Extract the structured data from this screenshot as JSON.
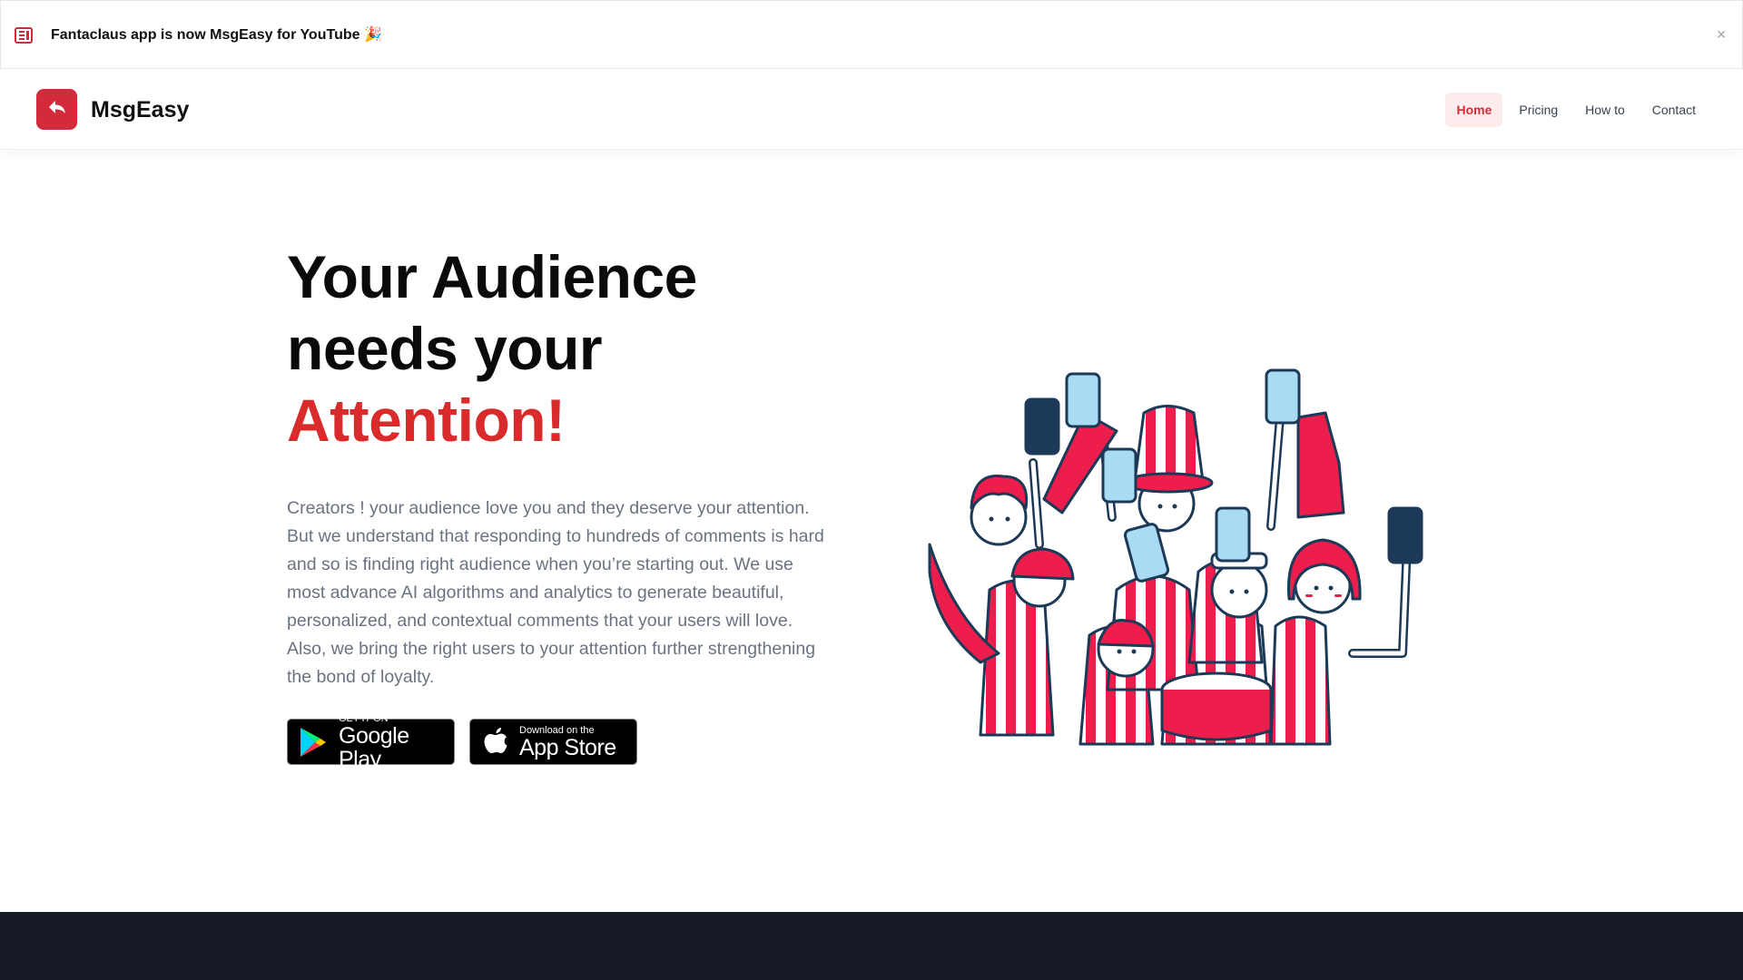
{
  "banner": {
    "text": "Fantaclaus app is now MsgEasy for YouTube 🎉",
    "icon": "newspaper-icon",
    "close_label": "×"
  },
  "header": {
    "brand": "MsgEasy",
    "logo_icon": "reply-arrow-icon",
    "nav": [
      {
        "label": "Home",
        "active": true
      },
      {
        "label": "Pricing",
        "active": false
      },
      {
        "label": "How to",
        "active": false
      },
      {
        "label": "Contact",
        "active": false
      }
    ]
  },
  "hero": {
    "title_line1": "Your Audience",
    "title_line2": "needs your",
    "title_accent": "Attention!",
    "description": "Creators ! your audience love you and they deserve your attention. But we understand that responding to hundreds of comments is hard and so is finding right audience when you’re starting out. We use most advance AI algorithms and analytics to generate beautiful, personalized, and contextual comments that your users will love. Also, we bring the right users to your attention further strengthening the bond of loyalty.",
    "google_play": {
      "small": "GET IT ON",
      "big": "Google Play"
    },
    "app_store": {
      "small": "Download on the",
      "big": "App Store"
    }
  },
  "colors": {
    "brand": "#d42b3a",
    "accent_text": "#d92b2b",
    "nav_active_bg": "#fdecec",
    "footer_bg": "#161b26",
    "illustration_red": "#ee1e4c",
    "illustration_blue": "#a9dbf5",
    "illustration_navy": "#1c3a57"
  }
}
